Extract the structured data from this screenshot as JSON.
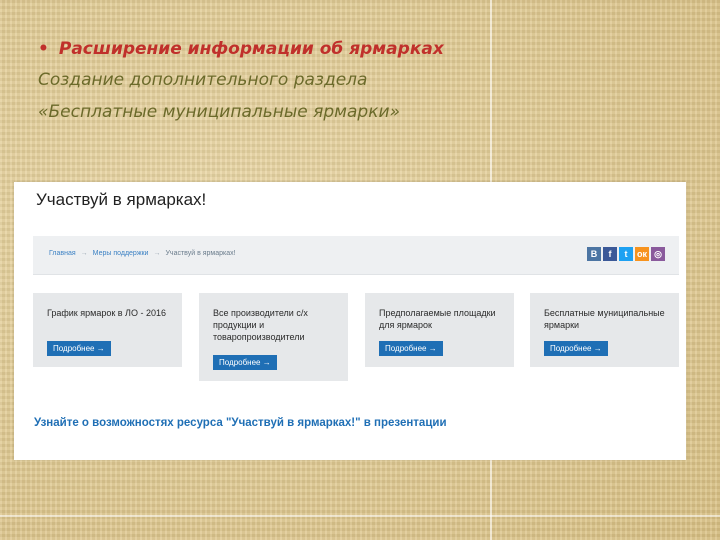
{
  "slide": {
    "bullet": "•",
    "heading": "Расширение информации об ярмарках",
    "line1": "Создание дополнительного раздела",
    "line2": "«Бесплатные муниципальные ярмарки»"
  },
  "site": {
    "title": "Участвуй в ярмарках!",
    "breadcrumbs": [
      "Главная",
      "Меры поддержки",
      "Участвуй в ярмарках!"
    ],
    "breadcrumb_separator": "→",
    "socials": [
      {
        "label": "В",
        "icon": "vk-icon",
        "color": "#4c75a3"
      },
      {
        "label": "f",
        "icon": "facebook-icon",
        "color": "#3b5998"
      },
      {
        "label": "t",
        "icon": "twitter-icon",
        "color": "#1da1f2"
      },
      {
        "label": "ок",
        "icon": "odnoklassniki-icon",
        "color": "#f7931e"
      },
      {
        "label": "◎",
        "icon": "instagram-icon",
        "color": "#8a5a9c"
      }
    ],
    "cards": [
      {
        "text": "График ярмарок в ЛО - 2016",
        "button": "Подробнее →"
      },
      {
        "text": "Все производители с/х продукции и товаропроизводители",
        "button": "Подробнее →"
      },
      {
        "text": "Предполагаемые площадки для ярмарок",
        "button": "Подробнее →"
      },
      {
        "text": "Бесплатные муниципальные ярмарки",
        "button": "Подробнее →"
      }
    ],
    "promo": "Узнайте о возможностях ресурса \"Участвуй в ярмарках!\" в презентации"
  }
}
